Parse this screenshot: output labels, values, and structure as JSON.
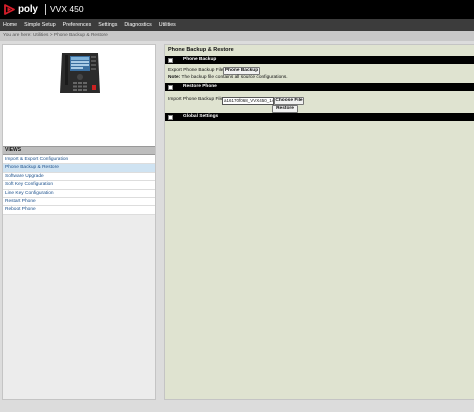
{
  "header": {
    "brand": "poly",
    "model": "VVX 450"
  },
  "nav": {
    "items": [
      "Home",
      "Simple Setup",
      "Preferences",
      "Settings",
      "Diagnostics",
      "Utilities"
    ]
  },
  "breadcrumb": "You are here: Utilities > Phone Backup & Restore",
  "sidebar": {
    "views_heading": "VIEWS",
    "items": [
      {
        "label": "Import & Export Configuration"
      },
      {
        "label": "Phone Backup & Restore",
        "active": true
      },
      {
        "label": "Software Upgrade"
      },
      {
        "label": "Soft Key Configuration"
      },
      {
        "label": "Line Key Configuration"
      },
      {
        "label": "Restart Phone"
      },
      {
        "label": "Reboot Phone"
      }
    ]
  },
  "main": {
    "title": "Phone Backup & Restore",
    "backup": {
      "section_title": "Phone Backup",
      "export_label": "Export Phone Backup File",
      "backup_button": "Phone Backup",
      "note_bold": "Note:",
      "note_text": " The backup file contains all source configurations."
    },
    "restore": {
      "section_title": "Restore Phone",
      "import_label": "Import Phone Backup File",
      "file_name": "a16170f068_VVX450_14-",
      "choose_button": "Choose File",
      "restore_button": "Restore"
    },
    "global": {
      "section_title": "Global Settings"
    }
  },
  "colors": {
    "header_bg": "#000000",
    "nav_bg": "#3c3c3c",
    "accent_red": "#d81e2a",
    "link": "#1a4f8b",
    "content_bg": "#dfe3d0"
  },
  "icons": {
    "logo": "poly-logo-icon",
    "phone": "desk-phone-image",
    "section_toggle": "square-toggle-icon"
  }
}
